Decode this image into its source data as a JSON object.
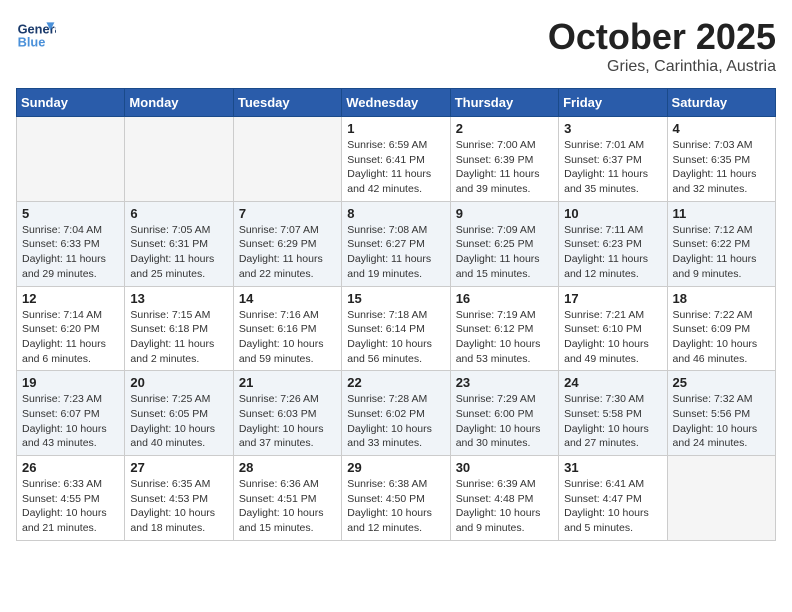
{
  "header": {
    "logo_general": "General",
    "logo_blue": "Blue",
    "month_title": "October 2025",
    "location": "Gries, Carinthia, Austria"
  },
  "days_of_week": [
    "Sunday",
    "Monday",
    "Tuesday",
    "Wednesday",
    "Thursday",
    "Friday",
    "Saturday"
  ],
  "weeks": [
    [
      {
        "day": "",
        "info": ""
      },
      {
        "day": "",
        "info": ""
      },
      {
        "day": "",
        "info": ""
      },
      {
        "day": "1",
        "info": "Sunrise: 6:59 AM\nSunset: 6:41 PM\nDaylight: 11 hours\nand 42 minutes."
      },
      {
        "day": "2",
        "info": "Sunrise: 7:00 AM\nSunset: 6:39 PM\nDaylight: 11 hours\nand 39 minutes."
      },
      {
        "day": "3",
        "info": "Sunrise: 7:01 AM\nSunset: 6:37 PM\nDaylight: 11 hours\nand 35 minutes."
      },
      {
        "day": "4",
        "info": "Sunrise: 7:03 AM\nSunset: 6:35 PM\nDaylight: 11 hours\nand 32 minutes."
      }
    ],
    [
      {
        "day": "5",
        "info": "Sunrise: 7:04 AM\nSunset: 6:33 PM\nDaylight: 11 hours\nand 29 minutes."
      },
      {
        "day": "6",
        "info": "Sunrise: 7:05 AM\nSunset: 6:31 PM\nDaylight: 11 hours\nand 25 minutes."
      },
      {
        "day": "7",
        "info": "Sunrise: 7:07 AM\nSunset: 6:29 PM\nDaylight: 11 hours\nand 22 minutes."
      },
      {
        "day": "8",
        "info": "Sunrise: 7:08 AM\nSunset: 6:27 PM\nDaylight: 11 hours\nand 19 minutes."
      },
      {
        "day": "9",
        "info": "Sunrise: 7:09 AM\nSunset: 6:25 PM\nDaylight: 11 hours\nand 15 minutes."
      },
      {
        "day": "10",
        "info": "Sunrise: 7:11 AM\nSunset: 6:23 PM\nDaylight: 11 hours\nand 12 minutes."
      },
      {
        "day": "11",
        "info": "Sunrise: 7:12 AM\nSunset: 6:22 PM\nDaylight: 11 hours\nand 9 minutes."
      }
    ],
    [
      {
        "day": "12",
        "info": "Sunrise: 7:14 AM\nSunset: 6:20 PM\nDaylight: 11 hours\nand 6 minutes."
      },
      {
        "day": "13",
        "info": "Sunrise: 7:15 AM\nSunset: 6:18 PM\nDaylight: 11 hours\nand 2 minutes."
      },
      {
        "day": "14",
        "info": "Sunrise: 7:16 AM\nSunset: 6:16 PM\nDaylight: 10 hours\nand 59 minutes."
      },
      {
        "day": "15",
        "info": "Sunrise: 7:18 AM\nSunset: 6:14 PM\nDaylight: 10 hours\nand 56 minutes."
      },
      {
        "day": "16",
        "info": "Sunrise: 7:19 AM\nSunset: 6:12 PM\nDaylight: 10 hours\nand 53 minutes."
      },
      {
        "day": "17",
        "info": "Sunrise: 7:21 AM\nSunset: 6:10 PM\nDaylight: 10 hours\nand 49 minutes."
      },
      {
        "day": "18",
        "info": "Sunrise: 7:22 AM\nSunset: 6:09 PM\nDaylight: 10 hours\nand 46 minutes."
      }
    ],
    [
      {
        "day": "19",
        "info": "Sunrise: 7:23 AM\nSunset: 6:07 PM\nDaylight: 10 hours\nand 43 minutes."
      },
      {
        "day": "20",
        "info": "Sunrise: 7:25 AM\nSunset: 6:05 PM\nDaylight: 10 hours\nand 40 minutes."
      },
      {
        "day": "21",
        "info": "Sunrise: 7:26 AM\nSunset: 6:03 PM\nDaylight: 10 hours\nand 37 minutes."
      },
      {
        "day": "22",
        "info": "Sunrise: 7:28 AM\nSunset: 6:02 PM\nDaylight: 10 hours\nand 33 minutes."
      },
      {
        "day": "23",
        "info": "Sunrise: 7:29 AM\nSunset: 6:00 PM\nDaylight: 10 hours\nand 30 minutes."
      },
      {
        "day": "24",
        "info": "Sunrise: 7:30 AM\nSunset: 5:58 PM\nDaylight: 10 hours\nand 27 minutes."
      },
      {
        "day": "25",
        "info": "Sunrise: 7:32 AM\nSunset: 5:56 PM\nDaylight: 10 hours\nand 24 minutes."
      }
    ],
    [
      {
        "day": "26",
        "info": "Sunrise: 6:33 AM\nSunset: 4:55 PM\nDaylight: 10 hours\nand 21 minutes."
      },
      {
        "day": "27",
        "info": "Sunrise: 6:35 AM\nSunset: 4:53 PM\nDaylight: 10 hours\nand 18 minutes."
      },
      {
        "day": "28",
        "info": "Sunrise: 6:36 AM\nSunset: 4:51 PM\nDaylight: 10 hours\nand 15 minutes."
      },
      {
        "day": "29",
        "info": "Sunrise: 6:38 AM\nSunset: 4:50 PM\nDaylight: 10 hours\nand 12 minutes."
      },
      {
        "day": "30",
        "info": "Sunrise: 6:39 AM\nSunset: 4:48 PM\nDaylight: 10 hours\nand 9 minutes."
      },
      {
        "day": "31",
        "info": "Sunrise: 6:41 AM\nSunset: 4:47 PM\nDaylight: 10 hours\nand 5 minutes."
      },
      {
        "day": "",
        "info": ""
      }
    ]
  ]
}
